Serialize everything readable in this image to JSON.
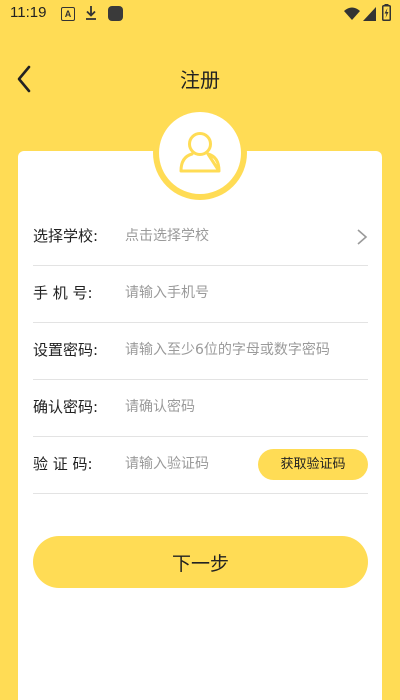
{
  "status_bar": {
    "time": "11:19",
    "icons": [
      "a-badge-icon",
      "download-icon",
      "app-icon",
      "wifi-icon",
      "signal-icon",
      "battery-icon"
    ]
  },
  "header": {
    "back_icon": "chevron-left-icon",
    "title": "注册"
  },
  "avatar": {
    "icon": "user-icon"
  },
  "form": {
    "school": {
      "label": "选择学校:",
      "placeholder": "点击选择学校",
      "icon": "chevron-right-icon"
    },
    "phone": {
      "label": "手 机 号:",
      "placeholder": "请输入手机号"
    },
    "password": {
      "label": "设置密码:",
      "placeholder": "请输入至少6位的字母或数字密码"
    },
    "confirm_password": {
      "label": "确认密码:",
      "placeholder": "请确认密码"
    },
    "verification_code": {
      "label": "验 证 码:",
      "placeholder": "请输入验证码",
      "button_label": "获取验证码"
    }
  },
  "next_button": {
    "label": "下一步"
  },
  "colors": {
    "accent": "#FFDC55",
    "card": "#FFFFFF",
    "placeholder": "#9A9A9A",
    "divider": "#E3E3E3"
  }
}
